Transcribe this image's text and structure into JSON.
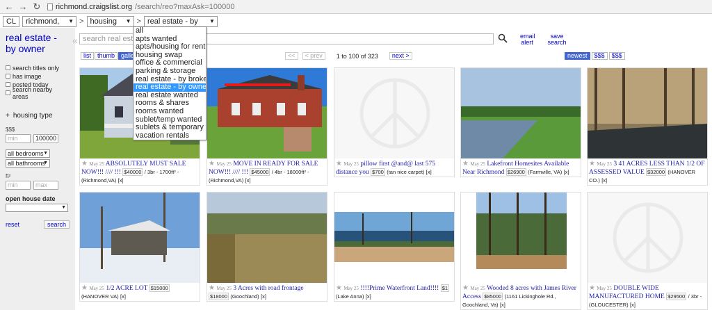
{
  "browser": {
    "url_host": "richmond.craigslist.org",
    "url_path": "/search/reo?maxAsk=100000"
  },
  "header": {
    "logo": "CL",
    "area": "richmond, VA",
    "category": "housing",
    "subcategory": "real estate - by owner"
  },
  "dropdown": {
    "options": [
      "all",
      "apts wanted",
      "apts/housing for rent",
      "housing swap",
      "office & commercial",
      "parking & storage",
      "real estate - by broker",
      "real estate - by owner",
      "real estate wanted",
      "rooms & shares",
      "rooms wanted",
      "sublet/temp wanted",
      "sublets & temporary",
      "vacation rentals"
    ],
    "selected_index": 7
  },
  "sidebar": {
    "title": "real estate - by owner",
    "checks": [
      "search titles only",
      "has image",
      "posted today",
      "search nearby areas"
    ],
    "housing_type": "housing type",
    "price_label": "$$$",
    "min_placeholder": "min",
    "max_value": "100000",
    "bedrooms": "all bedrooms",
    "bathrooms": "all bathrooms",
    "sqft_label": "ft²",
    "sqft_min_placeholder": "min",
    "sqft_max_placeholder": "max",
    "open_house": "open house date",
    "reset": "reset",
    "search": "search"
  },
  "search": {
    "placeholder": "search real estate",
    "email_alert": "email alert",
    "save_search": "save search"
  },
  "views": [
    "list",
    "thumb",
    "gallery"
  ],
  "pager": {
    "prev_first": "<<",
    "prev": "< prev",
    "count": "1 to 100 of 323",
    "next": "next >"
  },
  "sort": [
    "newest",
    "$$$",
    "$$$"
  ],
  "listings": [
    {
      "date": "May 25",
      "title": "ABSOLUTELY MUST SALE NOW!!! //// !!!",
      "price": "$40000",
      "details": "/ 3br - 1700ft² -",
      "loc": "(Richmond,VA)",
      "x": "[x]"
    },
    {
      "date": "May 25",
      "title": "MOVE IN READY FOR SALE NOW!!! //// !!!",
      "price": "$45000",
      "details": "/ 4br - 18000ft² -",
      "loc": "(Richmond,VA)",
      "x": "[x]"
    },
    {
      "date": "May 25",
      "title": "pillow first @and@ last 575 distance you",
      "price": "$700",
      "details": "",
      "loc": "(tan nice carpet)",
      "x": "[x]"
    },
    {
      "date": "May 25",
      "title": "Lakefront Homesites Available Near Richmond",
      "price": "$26900",
      "details": "",
      "loc": "(Farmville, VA)",
      "x": "[x]"
    },
    {
      "date": "May 25",
      "title": "3 41 ACRES LESS THAN 1/2 OF ASSESSED VALUE",
      "price": "$32000",
      "details": "",
      "loc": "(HANOVER CO.)",
      "x": "[x]"
    },
    {
      "date": "May 25",
      "title": "1/2 ACRE LOT",
      "price": "$15000",
      "details": "",
      "loc": "(HANOVER VA)",
      "x": "[x]"
    },
    {
      "date": "May 25",
      "title": "3 Acres with road frontage",
      "price": "$18000",
      "details": "",
      "loc": "(Goochland)",
      "x": "[x]"
    },
    {
      "date": "May 25",
      "title": "!!!!Prime Waterfront Land!!!!",
      "price": "$1",
      "details": "",
      "loc": "(Lake Anna)",
      "x": "[x]"
    },
    {
      "date": "May 25",
      "title": "Wooded 8 acres with James River Access",
      "price": "$85000",
      "details": "",
      "loc": "(1161 Lickinghole Rd., Goochland, Va)",
      "x": "[x]"
    },
    {
      "date": "May 25",
      "title": "DOUBLE WIDE MANUFACTURED HOME",
      "price": "$29500",
      "details": "/ 3br -",
      "loc": "(GLOUCESTER)",
      "x": "[x]"
    }
  ]
}
